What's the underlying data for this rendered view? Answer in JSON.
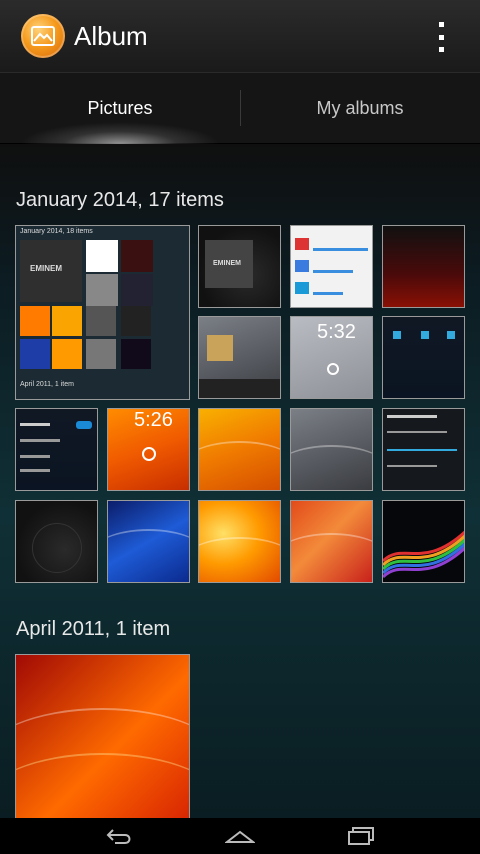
{
  "app": {
    "title": "Album",
    "icon": "album-picture-icon"
  },
  "overflow": {
    "icon": "overflow-menu-icon"
  },
  "tabs": [
    {
      "label": "Pictures",
      "active": true
    },
    {
      "label": "My albums",
      "active": false
    }
  ],
  "sections": [
    {
      "title": "January 2014, 17 items",
      "thumbs": [
        {
          "label": "January 2014, 18 items",
          "caption": "April 2011, 1 item",
          "overlay": "EMINEM"
        },
        {
          "overlay": "EMINEM"
        },
        {},
        {},
        {},
        {},
        {
          "clock": "5:32"
        },
        {},
        {},
        {
          "clock": "5:26"
        },
        {},
        {},
        {},
        {},
        {},
        {},
        {}
      ]
    },
    {
      "title": "April 2011, 1 item",
      "thumbs": [
        {}
      ]
    }
  ],
  "navbar": {
    "back_icon": "back-arrow-icon",
    "home_icon": "home-icon",
    "recents_icon": "recent-apps-icon"
  },
  "colors": {
    "actionbar": "#222222",
    "accent_orange": "#f59a1c",
    "content_teal": "#0f3036"
  }
}
